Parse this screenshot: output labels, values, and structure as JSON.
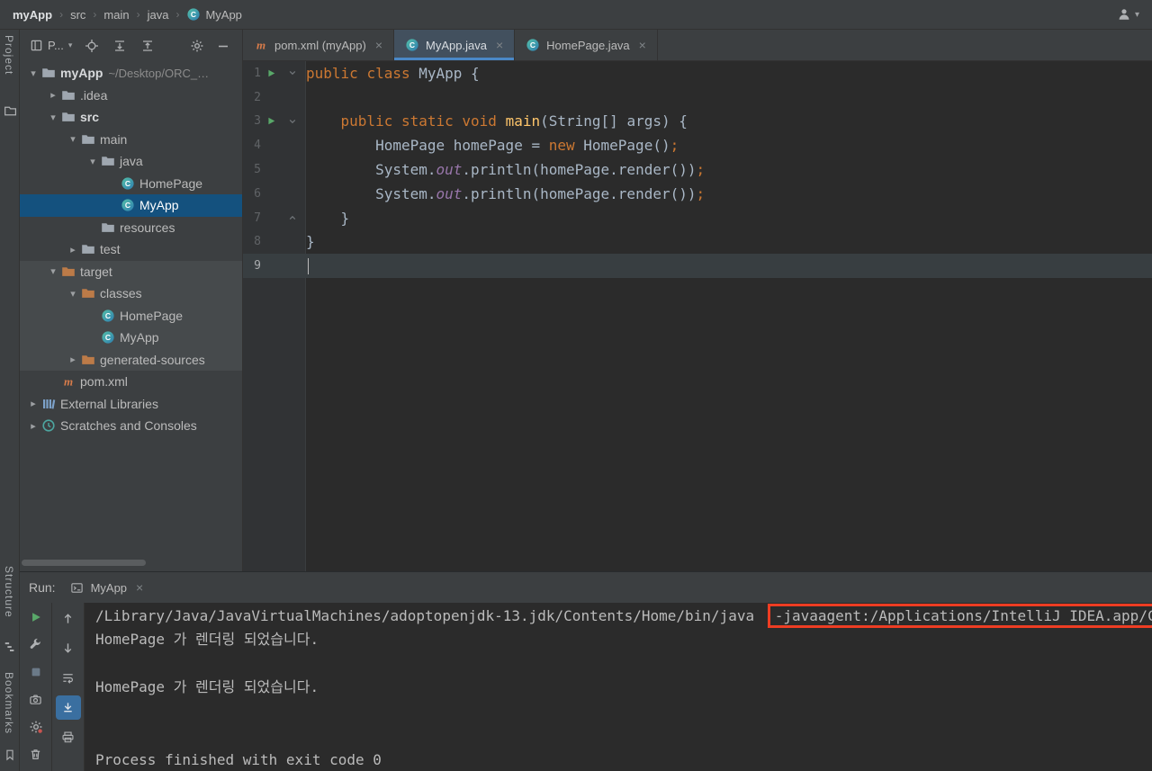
{
  "colors": {
    "accent_blue": "#4A88C7",
    "selection_blue": "#14517E",
    "banded_row": "#464A4C",
    "annotation_red": "#EE3D23",
    "keyword_orange": "#CC7832",
    "method_yellow": "#FFC66B",
    "field_purple": "#9876AA",
    "run_green": "#59A869"
  },
  "topbar": {
    "breadcrumbs": [
      {
        "label": "myApp",
        "bold": true
      },
      {
        "label": "src"
      },
      {
        "label": "main"
      },
      {
        "label": "java"
      },
      {
        "label": "MyApp",
        "icon": "class-icon"
      }
    ]
  },
  "tool_stripe": {
    "project_label": "Project",
    "structure_label": "Structure",
    "bookmarks_label": "Bookmarks"
  },
  "project_panel": {
    "selector_label": "P...",
    "header_icons": [
      "locate-icon",
      "expand-all-icon",
      "collapse-all-icon",
      "settings-gear-icon",
      "hide-icon"
    ],
    "tree": [
      {
        "label": "myApp",
        "hint": "~/Desktop/ORC_…",
        "indent": 0,
        "chevron": "down",
        "icon": "folder-icon",
        "bold": true
      },
      {
        "label": ".idea",
        "indent": 1,
        "chevron": "right",
        "icon": "folder-icon"
      },
      {
        "label": "src",
        "indent": 1,
        "chevron": "down",
        "icon": "folder-icon",
        "bold": true
      },
      {
        "label": "main",
        "indent": 2,
        "chevron": "down",
        "icon": "folder-icon"
      },
      {
        "label": "java",
        "indent": 3,
        "chevron": "down",
        "icon": "folder-icon"
      },
      {
        "label": "HomePage",
        "indent": 4,
        "icon": "class-icon"
      },
      {
        "label": "MyApp",
        "indent": 4,
        "icon": "class-icon",
        "selected": true
      },
      {
        "label": "resources",
        "indent": 3,
        "icon": "folder-icon"
      },
      {
        "label": "test",
        "indent": 2,
        "chevron": "right",
        "icon": "folder-icon"
      },
      {
        "label": "target",
        "indent": 1,
        "chevron": "down",
        "icon": "excluded-folder-icon",
        "banded": true
      },
      {
        "label": "classes",
        "indent": 2,
        "chevron": "down",
        "icon": "excluded-folder-icon",
        "banded": true
      },
      {
        "label": "HomePage",
        "indent": 3,
        "icon": "class-icon",
        "banded": true
      },
      {
        "label": "MyApp",
        "indent": 3,
        "icon": "class-icon",
        "banded": true
      },
      {
        "label": "generated-sources",
        "indent": 2,
        "chevron": "right",
        "icon": "excluded-folder-icon",
        "banded": true
      },
      {
        "label": "pom.xml",
        "indent": 1,
        "icon": "maven-icon"
      },
      {
        "label": "External Libraries",
        "indent": 0,
        "chevron": "right",
        "icon": "libraries-icon"
      },
      {
        "label": "Scratches and Consoles",
        "indent": 0,
        "chevron": "right",
        "icon": "scratches-icon"
      }
    ]
  },
  "editor": {
    "tabs": [
      {
        "label": "pom.xml (myApp)",
        "icon": "maven-icon"
      },
      {
        "label": "MyApp.java",
        "icon": "class-icon",
        "active": true
      },
      {
        "label": "HomePage.java",
        "icon": "class-icon"
      }
    ],
    "lines": [
      {
        "num": "1",
        "run": true,
        "fold": "start",
        "tokens": [
          [
            "kw",
            "public"
          ],
          [
            "pl",
            " "
          ],
          [
            "kw",
            "class"
          ],
          [
            "pl",
            " MyApp {"
          ]
        ]
      },
      {
        "num": "2",
        "tokens": []
      },
      {
        "num": "3",
        "run": true,
        "fold": "start",
        "tokens": [
          [
            "pl",
            "    "
          ],
          [
            "kw",
            "public"
          ],
          [
            "pl",
            " "
          ],
          [
            "kw",
            "static"
          ],
          [
            "pl",
            " "
          ],
          [
            "kw",
            "void"
          ],
          [
            "pl",
            " "
          ],
          [
            "fn",
            "main"
          ],
          [
            "pl",
            "(String[] args) {"
          ]
        ]
      },
      {
        "num": "4",
        "tokens": [
          [
            "pl",
            "        HomePage homePage = "
          ],
          [
            "kw",
            "new"
          ],
          [
            "pl",
            " HomePage()"
          ],
          [
            "kw",
            ";"
          ]
        ]
      },
      {
        "num": "5",
        "tokens": [
          [
            "pl",
            "        System."
          ],
          [
            "fd",
            "out"
          ],
          [
            "pl",
            ".println(homePage.render())"
          ],
          [
            "kw",
            ";"
          ]
        ]
      },
      {
        "num": "6",
        "tokens": [
          [
            "pl",
            "        System."
          ],
          [
            "fd",
            "out"
          ],
          [
            "pl",
            ".println(homePage.render())"
          ],
          [
            "kw",
            ";"
          ]
        ]
      },
      {
        "num": "7",
        "fold": "end",
        "tokens": [
          [
            "pl",
            "    }"
          ]
        ]
      },
      {
        "num": "8",
        "tokens": [
          [
            "pl",
            "}"
          ]
        ]
      },
      {
        "num": "9",
        "current": true,
        "tokens": []
      }
    ]
  },
  "run_panel": {
    "label": "Run:",
    "tab_label": "MyApp",
    "toolbar_left": [
      {
        "icon": "rerun-icon"
      },
      {
        "icon": "wrench-icon"
      },
      {
        "icon": "stop-icon"
      },
      {
        "icon": "camera-icon"
      },
      {
        "icon": "gear-icon"
      },
      {
        "icon": "trash-icon"
      }
    ],
    "toolbar_right": [
      {
        "icon": "up-arrow-icon"
      },
      {
        "icon": "down-arrow-icon"
      },
      {
        "icon": "soft-wrap-icon"
      },
      {
        "icon": "scroll-to-end-icon",
        "active": true
      },
      {
        "icon": "print-icon"
      }
    ],
    "console_lines": [
      {
        "segments": [
          {
            "text": "/Library/Java/JavaVirtualMachines/adoptopenjdk-13.jdk/Contents/Home/bin/java "
          },
          {
            "text": "-javaagent:/Applications/IntelliJ IDEA.app/C",
            "boxed": true
          }
        ]
      },
      {
        "segments": [
          {
            "text": "HomePage 가 렌더링 되었습니다."
          }
        ]
      },
      {
        "segments": []
      },
      {
        "segments": [
          {
            "text": "HomePage 가 렌더링 되었습니다."
          }
        ]
      },
      {
        "segments": []
      },
      {
        "segments": []
      },
      {
        "segments": [
          {
            "text": "Process finished with exit code 0"
          }
        ]
      }
    ]
  }
}
